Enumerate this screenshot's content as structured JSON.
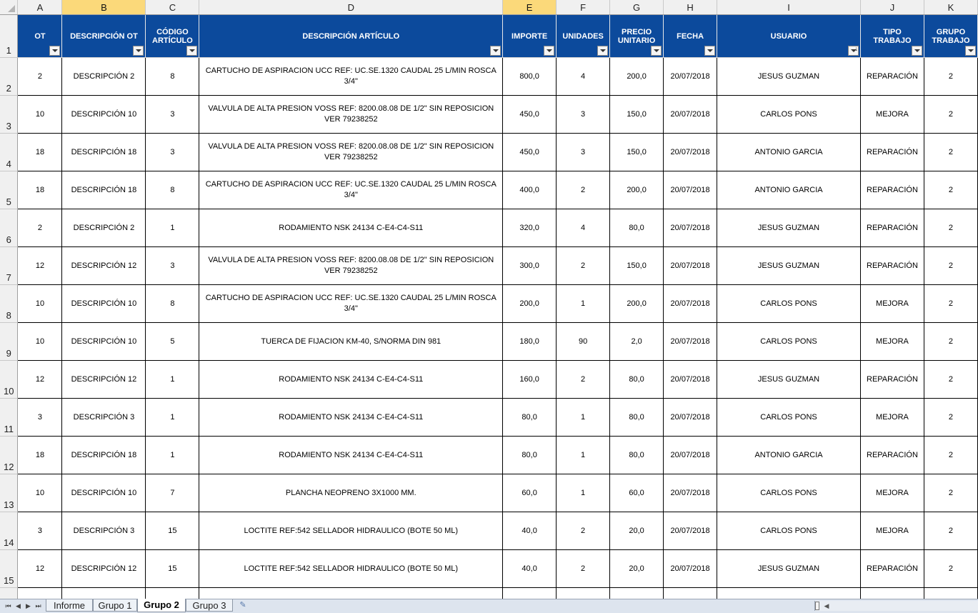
{
  "columns": [
    "A",
    "B",
    "C",
    "D",
    "E",
    "F",
    "G",
    "H",
    "I",
    "J",
    "K"
  ],
  "selected_columns": [
    "B",
    "E"
  ],
  "headers": [
    "OT",
    "DESCRIPCIÓN OT",
    "CÓDIGO ARTÍCULO",
    "DESCRIPCIÓN ARTÍCULO",
    "IMPORTE",
    "UNIDADES",
    "PRECIO UNITARIO",
    "FECHA",
    "USUARIO",
    "TIPO TRABAJO",
    "GRUPO TRABAJO"
  ],
  "row_numbers": [
    "1",
    "2",
    "3",
    "4",
    "5",
    "6",
    "7",
    "8",
    "9",
    "10",
    "11",
    "12",
    "13",
    "14",
    "15"
  ],
  "rows": [
    [
      "2",
      "DESCRIPCIÓN 2",
      "8",
      "CARTUCHO DE ASPIRACION UCC REF: UC.SE.1320 CAUDAL 25 L/MIN ROSCA 3/4\"",
      "800,0",
      "4",
      "200,0",
      "20/07/2018",
      "JESUS GUZMAN",
      "REPARACIÓN",
      "2"
    ],
    [
      "10",
      "DESCRIPCIÓN 10",
      "3",
      "VALVULA DE ALTA PRESION VOSS REF: 8200.08.08 DE 1/2\"           SIN REPOSICION VER 79238252",
      "450,0",
      "3",
      "150,0",
      "20/07/2018",
      "CARLOS PONS",
      "MEJORA",
      "2"
    ],
    [
      "18",
      "DESCRIPCIÓN 18",
      "3",
      "VALVULA DE ALTA PRESION VOSS REF: 8200.08.08 DE 1/2\"           SIN REPOSICION VER 79238252",
      "450,0",
      "3",
      "150,0",
      "20/07/2018",
      "ANTONIO GARCIA",
      "REPARACIÓN",
      "2"
    ],
    [
      "18",
      "DESCRIPCIÓN 18",
      "8",
      "CARTUCHO DE ASPIRACION UCC REF: UC.SE.1320 CAUDAL 25 L/MIN ROSCA 3/4\"",
      "400,0",
      "2",
      "200,0",
      "20/07/2018",
      "ANTONIO GARCIA",
      "REPARACIÓN",
      "2"
    ],
    [
      "2",
      "DESCRIPCIÓN 2",
      "1",
      "RODAMIENTO NSK 24134 C-E4-C4-S11",
      "320,0",
      "4",
      "80,0",
      "20/07/2018",
      "JESUS GUZMAN",
      "REPARACIÓN",
      "2"
    ],
    [
      "12",
      "DESCRIPCIÓN 12",
      "3",
      "VALVULA DE ALTA PRESION VOSS REF: 8200.08.08 DE 1/2\"           SIN REPOSICION VER 79238252",
      "300,0",
      "2",
      "150,0",
      "20/07/2018",
      "JESUS GUZMAN",
      "REPARACIÓN",
      "2"
    ],
    [
      "10",
      "DESCRIPCIÓN 10",
      "8",
      "CARTUCHO DE ASPIRACION UCC REF: UC.SE.1320 CAUDAL 25 L/MIN ROSCA 3/4\"",
      "200,0",
      "1",
      "200,0",
      "20/07/2018",
      "CARLOS PONS",
      "MEJORA",
      "2"
    ],
    [
      "10",
      "DESCRIPCIÓN 10",
      "5",
      "TUERCA DE FIJACION KM-40, S/NORMA DIN 981",
      "180,0",
      "90",
      "2,0",
      "20/07/2018",
      "CARLOS PONS",
      "MEJORA",
      "2"
    ],
    [
      "12",
      "DESCRIPCIÓN 12",
      "1",
      "RODAMIENTO NSK 24134 C-E4-C4-S11",
      "160,0",
      "2",
      "80,0",
      "20/07/2018",
      "JESUS GUZMAN",
      "REPARACIÓN",
      "2"
    ],
    [
      "3",
      "DESCRIPCIÓN 3",
      "1",
      "RODAMIENTO NSK 24134 C-E4-C4-S11",
      "80,0",
      "1",
      "80,0",
      "20/07/2018",
      "CARLOS PONS",
      "MEJORA",
      "2"
    ],
    [
      "18",
      "DESCRIPCIÓN 18",
      "1",
      "RODAMIENTO NSK 24134 C-E4-C4-S11",
      "80,0",
      "1",
      "80,0",
      "20/07/2018",
      "ANTONIO GARCIA",
      "REPARACIÓN",
      "2"
    ],
    [
      "10",
      "DESCRIPCIÓN 10",
      "7",
      "PLANCHA NEOPRENO 3X1000 MM.",
      "60,0",
      "1",
      "60,0",
      "20/07/2018",
      "CARLOS PONS",
      "MEJORA",
      "2"
    ],
    [
      "3",
      "DESCRIPCIÓN 3",
      "15",
      "LOCTITE REF:542 SELLADOR HIDRAULICO (BOTE 50 ML)",
      "40,0",
      "2",
      "20,0",
      "20/07/2018",
      "CARLOS PONS",
      "MEJORA",
      "2"
    ],
    [
      "12",
      "DESCRIPCIÓN 12",
      "15",
      "LOCTITE REF:542 SELLADOR HIDRAULICO (BOTE 50 ML)",
      "40,0",
      "2",
      "20,0",
      "20/07/2018",
      "JESUS GUZMAN",
      "REPARACIÓN",
      "2"
    ]
  ],
  "sheet_tabs": [
    "Informe",
    "Grupo 1",
    "Grupo 2",
    "Grupo 3"
  ],
  "active_tab": "Grupo 2",
  "colors": {
    "header_bg": "#0c4a9c",
    "selected_col_bg": "#fbd97a",
    "tabbar_bg": "#dde4ee"
  }
}
